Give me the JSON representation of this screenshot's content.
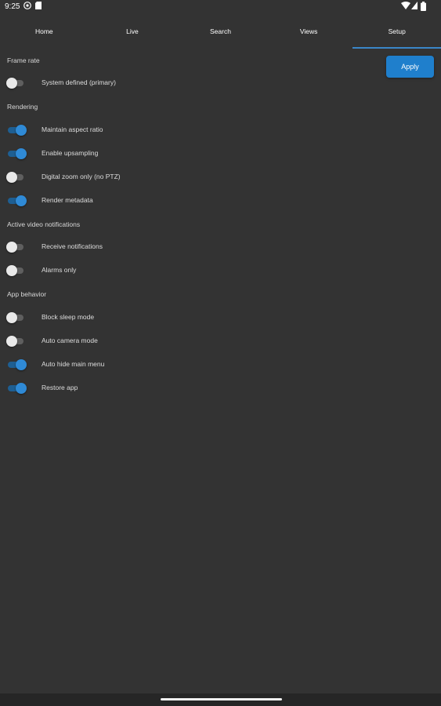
{
  "status": {
    "time": "9:25"
  },
  "tabs": [
    {
      "label": "Home"
    },
    {
      "label": "Live"
    },
    {
      "label": "Search"
    },
    {
      "label": "Views"
    },
    {
      "label": "Setup"
    }
  ],
  "active_tab": "Setup",
  "apply_label": "Apply",
  "accent_color": "#1f7fcc",
  "sections": {
    "frame_rate": {
      "title": "Frame rate",
      "items": [
        {
          "label": "System defined (primary)",
          "on": false
        }
      ]
    },
    "rendering": {
      "title": "Rendering",
      "items": [
        {
          "label": "Maintain aspect ratio",
          "on": true
        },
        {
          "label": "Enable upsampling",
          "on": true
        },
        {
          "label": "Digital zoom only (no PTZ)",
          "on": false
        },
        {
          "label": "Render metadata",
          "on": true
        }
      ]
    },
    "notifications": {
      "title": "Active video notifications",
      "items": [
        {
          "label": "Receive notifications",
          "on": false
        },
        {
          "label": "Alarms only",
          "on": false
        }
      ]
    },
    "app_behavior": {
      "title": "App behavior",
      "items": [
        {
          "label": "Block sleep mode",
          "on": false
        },
        {
          "label": "Auto camera mode",
          "on": false
        },
        {
          "label": "Auto hide main menu",
          "on": true
        },
        {
          "label": "Restore app",
          "on": true
        }
      ]
    }
  }
}
